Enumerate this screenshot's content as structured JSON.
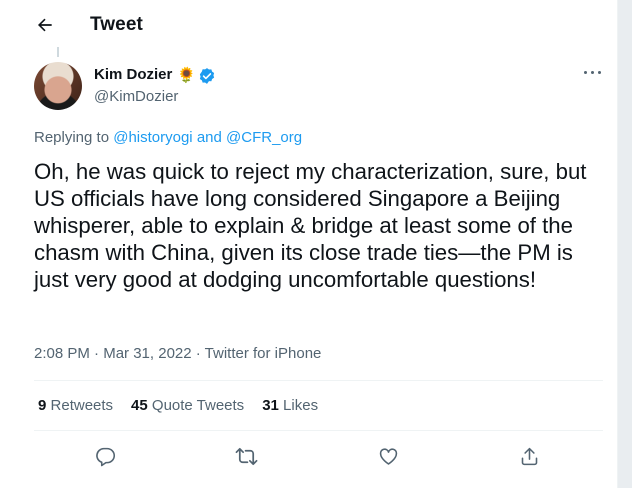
{
  "header": {
    "title": "Tweet"
  },
  "tweet": {
    "author_name": "Kim Dozier",
    "author_emoji": "🌻",
    "handle": "@KimDozier",
    "replying_prefix": "Replying to ",
    "reply_user_1": "@historyogi",
    "reply_and": " and ",
    "reply_user_2": "@CFR_org",
    "text": "Oh, he was quick to reject my characterization, sure, but US officials have long considered Singapore a Beijing whisperer, able to explain & bridge at least some of the chasm with China, given its close trade ties—the PM is just very good at dodging uncomfortable questions!",
    "time": "2:08 PM",
    "sep": " · ",
    "date": "Mar 31, 2022",
    "source": "Twitter for iPhone"
  },
  "stats": {
    "retweets_count": "9",
    "retweets_label": "Retweets",
    "quotes_count": "45",
    "quotes_label": "Quote Tweets",
    "likes_count": "31",
    "likes_label": "Likes"
  },
  "colors": {
    "accent": "#1d9bf0",
    "secondary_text": "#536471",
    "primary_text": "#0f1419"
  },
  "icons": [
    "back-arrow-icon",
    "verified-badge-icon",
    "more-icon",
    "reply-icon",
    "retweet-icon",
    "like-icon",
    "share-icon"
  ]
}
